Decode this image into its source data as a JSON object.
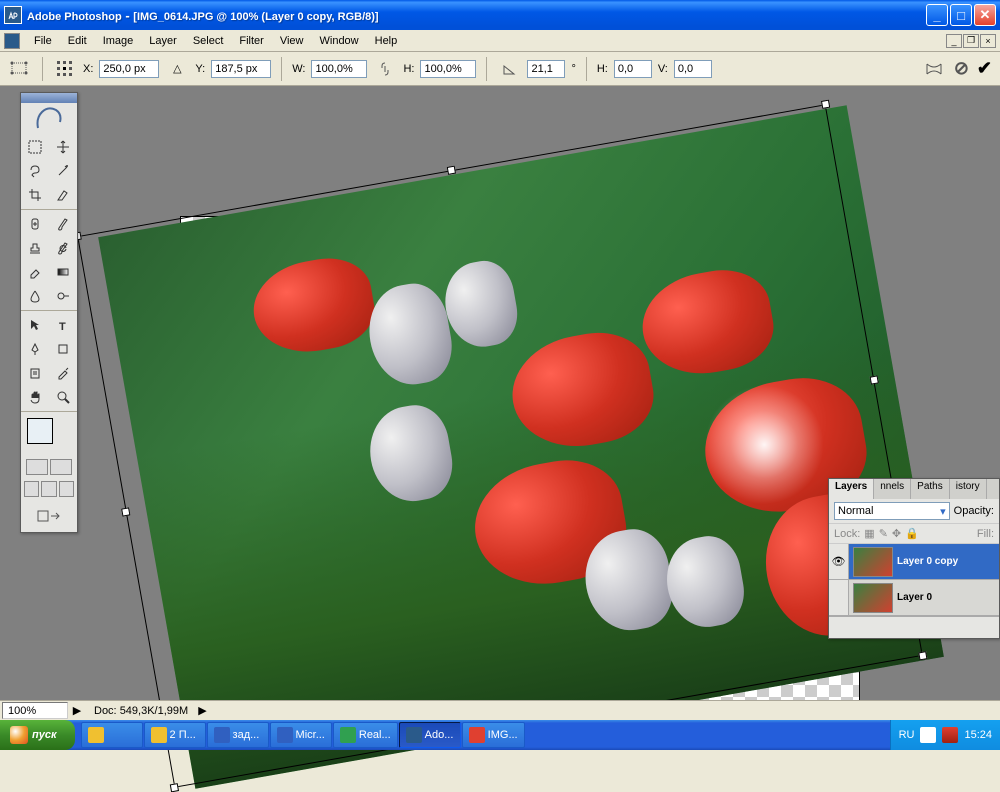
{
  "titlebar": {
    "app_name": "Adobe Photoshop",
    "document_title": "[IMG_0614.JPG @ 100% (Layer 0 copy, RGB/8)]"
  },
  "menu": {
    "items": [
      "File",
      "Edit",
      "Image",
      "Layer",
      "Select",
      "Filter",
      "View",
      "Window",
      "Help"
    ]
  },
  "options": {
    "x_label": "X:",
    "x_value": "250,0 px",
    "y_label": "Y:",
    "y_value": "187,5 px",
    "w_label": "W:",
    "w_value": "100,0%",
    "h_label": "H:",
    "h_value": "100,0%",
    "angle_value": "21,1",
    "angle_unit": "°",
    "hskew_label": "H:",
    "hskew_value": "0,0",
    "vskew_label": "V:",
    "vskew_value": "0,0"
  },
  "status": {
    "zoom": "100%",
    "doc_label": "Doc:",
    "doc_info": "549,3K/1,99M"
  },
  "layers_panel": {
    "tabs": [
      "Layers",
      "nnels",
      "Paths",
      "istory"
    ],
    "blend_mode": "Normal",
    "opacity_label": "Opacity:",
    "lock_label": "Lock:",
    "fill_label": "Fill:",
    "layers": [
      {
        "name": "Layer 0 copy",
        "visible": true,
        "active": true
      },
      {
        "name": "Layer 0",
        "visible": false,
        "active": false
      }
    ]
  },
  "taskbar": {
    "start_label": "пуск",
    "items": [
      {
        "label": "",
        "color": "#f0c030"
      },
      {
        "label": "2 П...",
        "color": "#f0c030"
      },
      {
        "label": "зад...",
        "color": "#3060c0"
      },
      {
        "label": "Micr...",
        "color": "#3060c0"
      },
      {
        "label": "Real...",
        "color": "#30a050"
      },
      {
        "label": "Ado...",
        "color": "#2a5a8a",
        "active": true
      },
      {
        "label": "IMG...",
        "color": "#e04030"
      }
    ],
    "tray": {
      "lang": "RU",
      "time": "15:24"
    }
  },
  "colors": {
    "xp_blue": "#245edb",
    "xp_green": "#3a8a28",
    "panel_bg": "#ece9d8",
    "selection_blue": "#316ac5"
  }
}
